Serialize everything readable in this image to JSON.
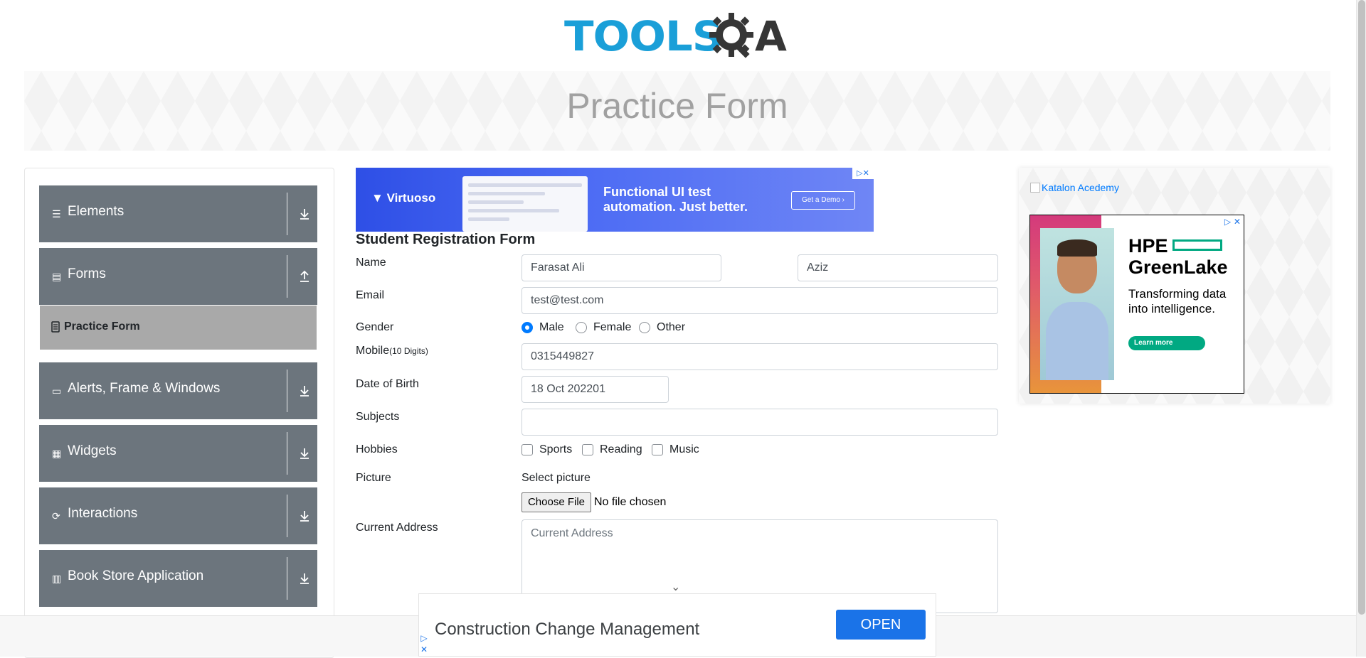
{
  "site": {
    "logo_text": "TOOLS",
    "logo_suffix": "A",
    "page_title": "Practice Form"
  },
  "sidebar": {
    "groups": [
      {
        "label": "Elements",
        "icon": "list-icon",
        "expanded": false
      },
      {
        "label": "Forms",
        "icon": "document-icon",
        "expanded": true
      },
      {
        "label": "Alerts, Frame & Windows",
        "icon": "window-icon",
        "expanded": false
      },
      {
        "label": "Widgets",
        "icon": "grid-icon",
        "expanded": false
      },
      {
        "label": "Interactions",
        "icon": "interaction-icon",
        "expanded": false
      },
      {
        "label": "Book Store Application",
        "icon": "books-icon",
        "expanded": false
      }
    ],
    "active_item": "Practice Form"
  },
  "ad_top": {
    "brand": "Virtuoso",
    "headline_1": "Functional UI test",
    "headline_2": "automation. Just better.",
    "cta": "Get a Demo  ›"
  },
  "form": {
    "title": "Student Registration Form",
    "labels": {
      "name": "Name",
      "email": "Email",
      "gender": "Gender",
      "mobile": "Mobile",
      "mobile_hint": "(10 Digits)",
      "dob": "Date of Birth",
      "subjects": "Subjects",
      "hobbies": "Hobbies",
      "picture": "Picture",
      "address": "Current Address"
    },
    "first_name": "Farasat Ali",
    "last_name": "Aziz",
    "email": "test@test.com",
    "gender_options": [
      "Male",
      "Female",
      "Other"
    ],
    "gender_selected": "Male",
    "mobile": "0315449827",
    "dob": "18 Oct 202201",
    "subjects": "",
    "hobbies": [
      "Sports",
      "Reading",
      "Music"
    ],
    "select_picture": "Select picture",
    "choose_file": "Choose File",
    "no_file": "No file chosen",
    "address_placeholder": "Current Address"
  },
  "right_ads": {
    "katalon_alt": "Katalon Acedemy",
    "hpe_title_1": "HPE",
    "hpe_title_2": "GreenLake",
    "hpe_sub_1": "Transforming data",
    "hpe_sub_2": "into intelligence.",
    "hpe_cta": "Learn more"
  },
  "bottom_ad": {
    "text": "Construction Change Management",
    "button": "OPEN"
  },
  "colors": {
    "sidebar_bg": "#6c757d",
    "sidebar_active": "#a9a9a9",
    "accent": "#007bff",
    "logo_blue": "#1a9fd8"
  }
}
